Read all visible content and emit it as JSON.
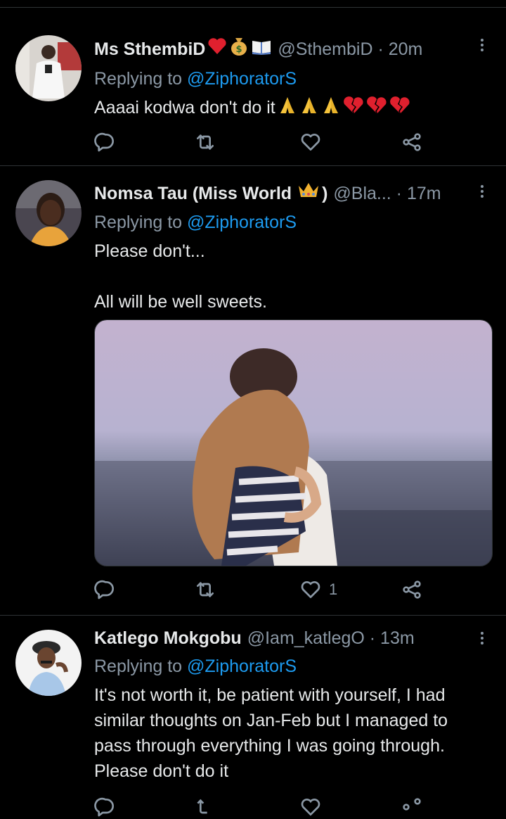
{
  "tweets": [
    {
      "name": "Ms SthembiD",
      "handle": "@SthembiD · 20m",
      "replying_prefix": "Replying to ",
      "replying_to": "@ZiphoratorS",
      "text": "Aaaai kodwa don't do it",
      "name_emojis": [
        "red-heart",
        "money-bag",
        "open-book"
      ],
      "text_emojis": [
        "folded-hands",
        "folded-hands",
        "folded-hands",
        "broken-heart",
        "broken-heart",
        "broken-heart"
      ],
      "like_count": ""
    },
    {
      "name": "Nomsa Tau (Miss World",
      "name_suffix": ")",
      "handle": "@Bla... · 17m",
      "replying_prefix": "Replying to ",
      "replying_to": "@ZiphoratorS",
      "text_line1": "Please don't...",
      "text_line2": "All will be well sweets.",
      "name_emojis": [
        "crown"
      ],
      "media": "couple-hugging-photo",
      "like_count": "1"
    },
    {
      "name": "Katlego Mokgobu",
      "handle": "@Iam_katlegO · 13m",
      "replying_prefix": "Replying to ",
      "replying_to": "@ZiphoratorS",
      "text": "It's not worth it, be patient with yourself, I had similar thoughts on Jan-Feb but I managed to pass through everything I was going through. Please don't do it",
      "like_count": ""
    }
  ],
  "colors": {
    "background": "#000000",
    "text": "#e7e9ea",
    "muted": "#8b98a5",
    "link": "#1d9bf0",
    "divider": "#2f3336"
  },
  "action_icons": [
    "reply-icon",
    "retweet-icon",
    "like-icon",
    "share-icon"
  ]
}
